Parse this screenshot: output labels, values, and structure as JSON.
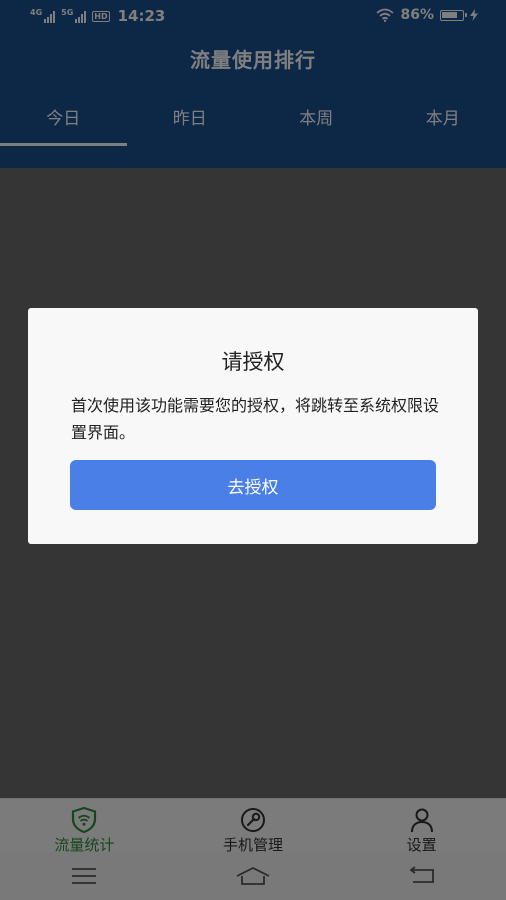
{
  "status_bar": {
    "net1": "4G",
    "net2": "5G",
    "hd": "HD",
    "time": "14:23",
    "battery": "86%",
    "battery_level": 0.86
  },
  "header": {
    "title": "流量使用排行",
    "tabs": [
      {
        "label": "今日",
        "active": true
      },
      {
        "label": "昨日",
        "active": false
      },
      {
        "label": "本周",
        "active": false
      },
      {
        "label": "本月",
        "active": false
      }
    ]
  },
  "bottom_nav": {
    "items": [
      {
        "label": "流量统计",
        "icon": "shield-wifi-icon",
        "active": true
      },
      {
        "label": "手机管理",
        "icon": "wrench-icon",
        "active": false
      },
      {
        "label": "设置",
        "icon": "person-icon",
        "active": false
      }
    ]
  },
  "dialog": {
    "title": "请授权",
    "message": "首次使用该功能需要您的授权，将跳转至系统权限设置界面。",
    "button": "去授权"
  },
  "colors": {
    "header_bg": "#1b4e8f",
    "accent_green": "#2e8b3a",
    "button_blue": "#4a7fe8"
  }
}
